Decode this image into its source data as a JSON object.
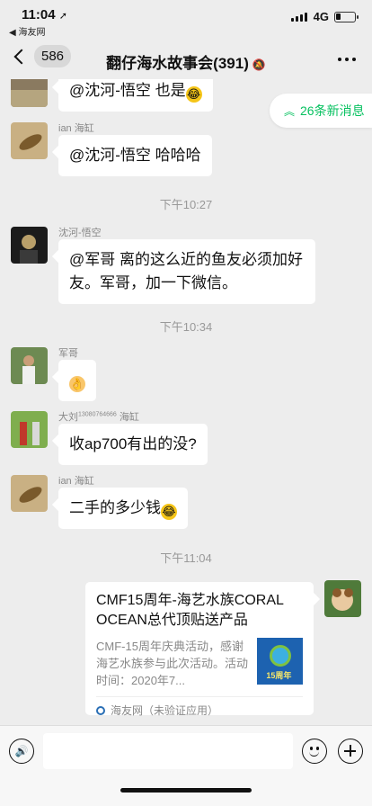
{
  "status": {
    "time": "11:04",
    "location_icon": "location-arrow-icon",
    "back_app": "◀ 海友网",
    "network": "4G",
    "battery_level": 0.2
  },
  "nav": {
    "unread_count": "586",
    "title": "翻仔海水故事会(391)",
    "mute_icon": "mute-bell-icon",
    "more_icon": "more-dots-icon"
  },
  "new_messages": {
    "icon": "double-chevron-up-icon",
    "label": "26条新消息"
  },
  "messages": [
    {
      "sender": "",
      "text": "@沈河-悟空 也是",
      "emoji": "😂"
    },
    {
      "sender": "ian 海缸",
      "text": "@沈河-悟空 哈哈哈",
      "emoji": ""
    },
    {
      "timestamp": "下午10:27"
    },
    {
      "sender": "沈河-悟空",
      "text": "@军哥 离的这么近的鱼友必须加好友。军哥，加一下微信。",
      "emoji": ""
    },
    {
      "timestamp": "下午10:34"
    },
    {
      "sender": "军哥",
      "text": "",
      "emoji": "👌"
    },
    {
      "sender": "大刘",
      "sender_sup": "13080764666",
      "sender_suffix": "海缸",
      "text": "收ap700有出的没?",
      "emoji": ""
    },
    {
      "sender": "ian 海缸",
      "text": "二手的多少钱",
      "emoji": "😂"
    },
    {
      "timestamp": "下午11:04"
    }
  ],
  "link_card": {
    "title": "CMF15周年-海艺水族CORAL OCEAN总代顶贴送产品",
    "description": "CMF-15周年庆典活动，感谢海艺水族参与此次活动。活动时间：2020年7...",
    "thumb_text": "15周年",
    "source": "海友网（未验证应用）"
  },
  "input_bar": {
    "placeholder": "",
    "voice_icon": "voice-icon",
    "emoji_icon": "emoji-icon",
    "plus_icon": "plus-icon"
  }
}
